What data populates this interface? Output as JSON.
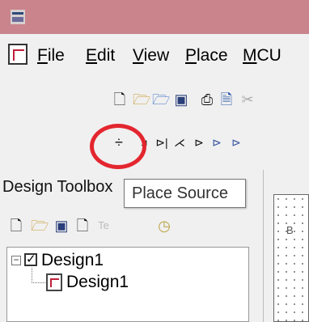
{
  "window": {
    "title_icon": "app-icon"
  },
  "menu": {
    "file": "File",
    "edit": "Edit",
    "view": "View",
    "place": "Place",
    "mcu": "MCU"
  },
  "toolbar": {
    "source_glyph": "÷",
    "tooltip": "Place Source"
  },
  "sidebar": {
    "title": "Design Toolbox",
    "tree": [
      {
        "label": "Design1"
      },
      {
        "label": "Design1"
      }
    ]
  },
  "canvas": {
    "sheet_label": "B"
  },
  "colors": {
    "titlebar": "#c9848c",
    "highlight_circle": "#e3262f"
  }
}
